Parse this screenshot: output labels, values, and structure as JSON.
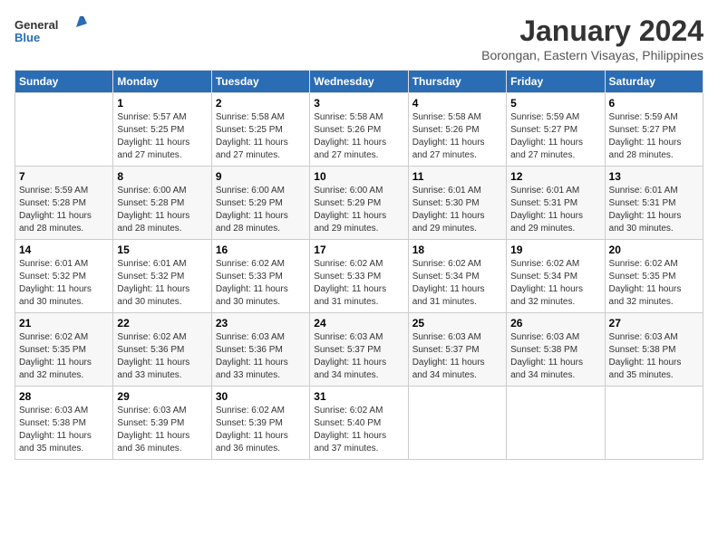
{
  "header": {
    "logo_line1": "General",
    "logo_line2": "Blue",
    "month": "January 2024",
    "location": "Borongan, Eastern Visayas, Philippines"
  },
  "days_of_week": [
    "Sunday",
    "Monday",
    "Tuesday",
    "Wednesday",
    "Thursday",
    "Friday",
    "Saturday"
  ],
  "weeks": [
    [
      {
        "num": "",
        "info": ""
      },
      {
        "num": "1",
        "info": "Sunrise: 5:57 AM\nSunset: 5:25 PM\nDaylight: 11 hours\nand 27 minutes."
      },
      {
        "num": "2",
        "info": "Sunrise: 5:58 AM\nSunset: 5:25 PM\nDaylight: 11 hours\nand 27 minutes."
      },
      {
        "num": "3",
        "info": "Sunrise: 5:58 AM\nSunset: 5:26 PM\nDaylight: 11 hours\nand 27 minutes."
      },
      {
        "num": "4",
        "info": "Sunrise: 5:58 AM\nSunset: 5:26 PM\nDaylight: 11 hours\nand 27 minutes."
      },
      {
        "num": "5",
        "info": "Sunrise: 5:59 AM\nSunset: 5:27 PM\nDaylight: 11 hours\nand 27 minutes."
      },
      {
        "num": "6",
        "info": "Sunrise: 5:59 AM\nSunset: 5:27 PM\nDaylight: 11 hours\nand 28 minutes."
      }
    ],
    [
      {
        "num": "7",
        "info": "Sunrise: 5:59 AM\nSunset: 5:28 PM\nDaylight: 11 hours\nand 28 minutes."
      },
      {
        "num": "8",
        "info": "Sunrise: 6:00 AM\nSunset: 5:28 PM\nDaylight: 11 hours\nand 28 minutes."
      },
      {
        "num": "9",
        "info": "Sunrise: 6:00 AM\nSunset: 5:29 PM\nDaylight: 11 hours\nand 28 minutes."
      },
      {
        "num": "10",
        "info": "Sunrise: 6:00 AM\nSunset: 5:29 PM\nDaylight: 11 hours\nand 29 minutes."
      },
      {
        "num": "11",
        "info": "Sunrise: 6:01 AM\nSunset: 5:30 PM\nDaylight: 11 hours\nand 29 minutes."
      },
      {
        "num": "12",
        "info": "Sunrise: 6:01 AM\nSunset: 5:31 PM\nDaylight: 11 hours\nand 29 minutes."
      },
      {
        "num": "13",
        "info": "Sunrise: 6:01 AM\nSunset: 5:31 PM\nDaylight: 11 hours\nand 30 minutes."
      }
    ],
    [
      {
        "num": "14",
        "info": "Sunrise: 6:01 AM\nSunset: 5:32 PM\nDaylight: 11 hours\nand 30 minutes."
      },
      {
        "num": "15",
        "info": "Sunrise: 6:01 AM\nSunset: 5:32 PM\nDaylight: 11 hours\nand 30 minutes."
      },
      {
        "num": "16",
        "info": "Sunrise: 6:02 AM\nSunset: 5:33 PM\nDaylight: 11 hours\nand 30 minutes."
      },
      {
        "num": "17",
        "info": "Sunrise: 6:02 AM\nSunset: 5:33 PM\nDaylight: 11 hours\nand 31 minutes."
      },
      {
        "num": "18",
        "info": "Sunrise: 6:02 AM\nSunset: 5:34 PM\nDaylight: 11 hours\nand 31 minutes."
      },
      {
        "num": "19",
        "info": "Sunrise: 6:02 AM\nSunset: 5:34 PM\nDaylight: 11 hours\nand 32 minutes."
      },
      {
        "num": "20",
        "info": "Sunrise: 6:02 AM\nSunset: 5:35 PM\nDaylight: 11 hours\nand 32 minutes."
      }
    ],
    [
      {
        "num": "21",
        "info": "Sunrise: 6:02 AM\nSunset: 5:35 PM\nDaylight: 11 hours\nand 32 minutes."
      },
      {
        "num": "22",
        "info": "Sunrise: 6:02 AM\nSunset: 5:36 PM\nDaylight: 11 hours\nand 33 minutes."
      },
      {
        "num": "23",
        "info": "Sunrise: 6:03 AM\nSunset: 5:36 PM\nDaylight: 11 hours\nand 33 minutes."
      },
      {
        "num": "24",
        "info": "Sunrise: 6:03 AM\nSunset: 5:37 PM\nDaylight: 11 hours\nand 34 minutes."
      },
      {
        "num": "25",
        "info": "Sunrise: 6:03 AM\nSunset: 5:37 PM\nDaylight: 11 hours\nand 34 minutes."
      },
      {
        "num": "26",
        "info": "Sunrise: 6:03 AM\nSunset: 5:38 PM\nDaylight: 11 hours\nand 34 minutes."
      },
      {
        "num": "27",
        "info": "Sunrise: 6:03 AM\nSunset: 5:38 PM\nDaylight: 11 hours\nand 35 minutes."
      }
    ],
    [
      {
        "num": "28",
        "info": "Sunrise: 6:03 AM\nSunset: 5:38 PM\nDaylight: 11 hours\nand 35 minutes."
      },
      {
        "num": "29",
        "info": "Sunrise: 6:03 AM\nSunset: 5:39 PM\nDaylight: 11 hours\nand 36 minutes."
      },
      {
        "num": "30",
        "info": "Sunrise: 6:02 AM\nSunset: 5:39 PM\nDaylight: 11 hours\nand 36 minutes."
      },
      {
        "num": "31",
        "info": "Sunrise: 6:02 AM\nSunset: 5:40 PM\nDaylight: 11 hours\nand 37 minutes."
      },
      {
        "num": "",
        "info": ""
      },
      {
        "num": "",
        "info": ""
      },
      {
        "num": "",
        "info": ""
      }
    ]
  ]
}
